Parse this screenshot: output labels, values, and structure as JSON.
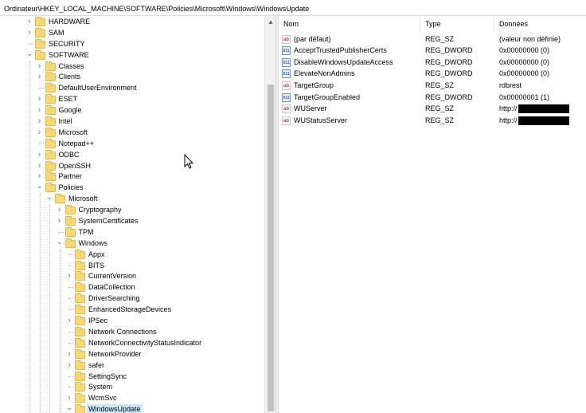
{
  "window": {
    "address_path": "Ordinateur\\HKEY_LOCAL_MACHINE\\SOFTWARE\\Policies\\Microsoft\\Windows\\WindowsUpdate"
  },
  "tree": {
    "rows": [
      {
        "label": "HARDWARE",
        "level": 0,
        "expander": "collapsed"
      },
      {
        "label": "SAM",
        "level": 0,
        "expander": "collapsed"
      },
      {
        "label": "SECURITY",
        "level": 0,
        "expander": "none"
      },
      {
        "label": "SOFTWARE",
        "level": 0,
        "expander": "expanded"
      },
      {
        "label": "Classes",
        "level": 1,
        "expander": "collapsed"
      },
      {
        "label": "Clients",
        "level": 1,
        "expander": "collapsed"
      },
      {
        "label": "DefaultUserEnvironment",
        "level": 1,
        "expander": "none"
      },
      {
        "label": "ESET",
        "level": 1,
        "expander": "collapsed"
      },
      {
        "label": "Google",
        "level": 1,
        "expander": "collapsed"
      },
      {
        "label": "Intel",
        "level": 1,
        "expander": "collapsed"
      },
      {
        "label": "Microsoft",
        "level": 1,
        "expander": "collapsed"
      },
      {
        "label": "Notepad++",
        "level": 1,
        "expander": "none"
      },
      {
        "label": "ODBC",
        "level": 1,
        "expander": "collapsed"
      },
      {
        "label": "OpenSSH",
        "level": 1,
        "expander": "collapsed"
      },
      {
        "label": "Partner",
        "level": 1,
        "expander": "collapsed"
      },
      {
        "label": "Policies",
        "level": 1,
        "expander": "expanded"
      },
      {
        "label": "Microsoft",
        "level": 2,
        "expander": "expanded"
      },
      {
        "label": "Cryptography",
        "level": 3,
        "expander": "collapsed"
      },
      {
        "label": "SystemCertificates",
        "level": 3,
        "expander": "collapsed"
      },
      {
        "label": "TPM",
        "level": 3,
        "expander": "none"
      },
      {
        "label": "Windows",
        "level": 3,
        "expander": "expanded"
      },
      {
        "label": "Appx",
        "level": 4,
        "expander": "none"
      },
      {
        "label": "BITS",
        "level": 4,
        "expander": "none"
      },
      {
        "label": "CurrentVersion",
        "level": 4,
        "expander": "collapsed"
      },
      {
        "label": "DataCollection",
        "level": 4,
        "expander": "none"
      },
      {
        "label": "DriverSearching",
        "level": 4,
        "expander": "none"
      },
      {
        "label": "EnhancedStorageDevices",
        "level": 4,
        "expander": "none"
      },
      {
        "label": "IPSec",
        "level": 4,
        "expander": "collapsed"
      },
      {
        "label": "Network Connections",
        "level": 4,
        "expander": "none"
      },
      {
        "label": "NetworkConnectivityStatusIndicator",
        "level": 4,
        "expander": "none"
      },
      {
        "label": "NetworkProvider",
        "level": 4,
        "expander": "collapsed"
      },
      {
        "label": "safer",
        "level": 4,
        "expander": "collapsed"
      },
      {
        "label": "SettingSync",
        "level": 4,
        "expander": "none"
      },
      {
        "label": "System",
        "level": 4,
        "expander": "none"
      },
      {
        "label": "WcmSvc",
        "level": 4,
        "expander": "collapsed"
      },
      {
        "label": "WindowsUpdate",
        "level": 4,
        "expander": "expanded",
        "selected": true
      }
    ]
  },
  "list": {
    "headers": {
      "name": "Nom",
      "type": "Type",
      "data": "Données"
    },
    "rows": [
      {
        "name": "(par défaut)",
        "type": "REG_SZ",
        "data": "(valeur non définie)",
        "icon": "reg-sz-icon",
        "redacted": false
      },
      {
        "name": "AcceptTrustedPublisherCerts",
        "type": "REG_DWORD",
        "data": "0x00000000 (0)",
        "icon": "reg-dword-icon",
        "redacted": false
      },
      {
        "name": "DisableWindowsUpdateAccess",
        "type": "REG_DWORD",
        "data": "0x00000000 (0)",
        "icon": "reg-dword-icon",
        "redacted": false
      },
      {
        "name": "ElevateNonAdmins",
        "type": "REG_DWORD",
        "data": "0x00000000 (0)",
        "icon": "reg-dword-icon",
        "redacted": false
      },
      {
        "name": "TargetGroup",
        "type": "REG_SZ",
        "data": "rdbrest",
        "icon": "reg-sz-icon",
        "redacted": false
      },
      {
        "name": "TargetGroupEnabled",
        "type": "REG_DWORD",
        "data": "0x00000001 (1)",
        "icon": "reg-dword-icon",
        "redacted": false
      },
      {
        "name": "WUServer",
        "type": "REG_SZ",
        "data": "http://",
        "icon": "reg-sz-icon",
        "redacted": true
      },
      {
        "name": "WUStatusServer",
        "type": "REG_SZ",
        "data": "http://",
        "icon": "reg-sz-icon",
        "redacted": true
      }
    ]
  },
  "icons": {
    "sz_glyph": "ab",
    "dword_glyph": "011"
  }
}
